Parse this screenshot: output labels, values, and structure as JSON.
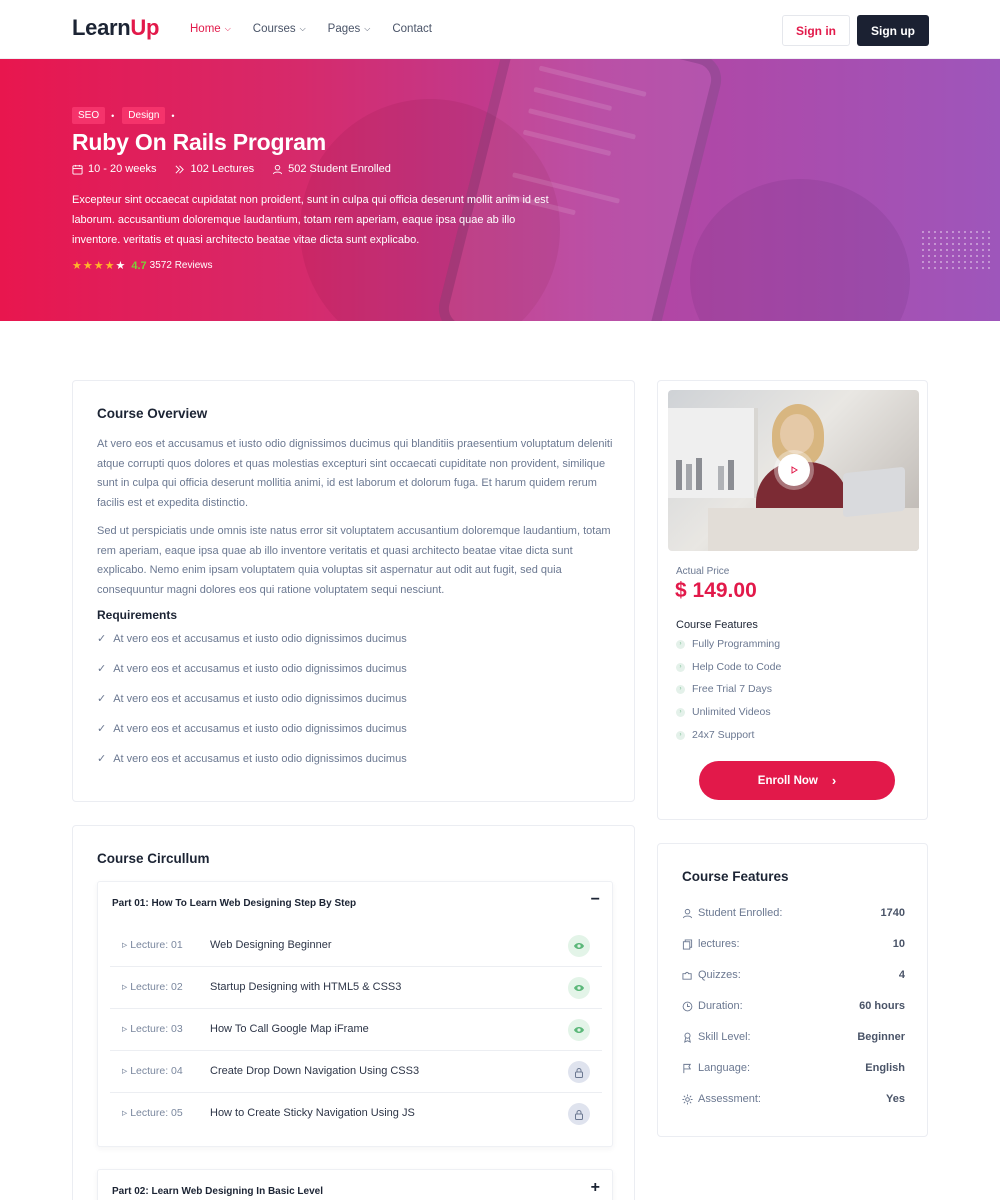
{
  "brand": {
    "logo_learn": "Learn",
    "logo_up": "Up"
  },
  "nav": {
    "items": [
      {
        "label": "Home",
        "has_dropdown": true,
        "active": true
      },
      {
        "label": "Courses",
        "has_dropdown": true,
        "active": false
      },
      {
        "label": "Pages",
        "has_dropdown": true,
        "active": false
      },
      {
        "label": "Contact",
        "has_dropdown": false,
        "active": false
      }
    ],
    "signin_label": "Sign in",
    "signup_label": "Sign up"
  },
  "hero": {
    "tags": [
      "SEO",
      "Design"
    ],
    "title": "Ruby On Rails Program",
    "meta": {
      "duration": "10 - 20 weeks",
      "lectures": "102 Lectures",
      "enrolled": "502 Student Enrolled"
    },
    "description": "Excepteur sint occaecat cupidatat non proident, sunt in culpa qui officia deserunt mollit anim id est laborum. accusantium doloremque laudantium, totam rem aperiam, eaque ipsa quae ab illo inventore. veritatis et quasi architecto beatae vitae dicta sunt explicabo.",
    "rating": {
      "stars": 4.5,
      "value": "4.7",
      "reviews": "3572 Reviews"
    }
  },
  "overview": {
    "title": "Course Overview",
    "paragraph1": "At vero eos et accusamus et iusto odio dignissimos ducimus qui blanditiis praesentium voluptatum deleniti atque corrupti quos dolores et quas molestias excepturi sint occaecati cupiditate non provident, similique sunt in culpa qui officia deserunt mollitia animi, id est laborum et dolorum fuga. Et harum quidem rerum facilis est et expedita distinctio.",
    "paragraph2": "Sed ut perspiciatis unde omnis iste natus error sit voluptatem accusantium doloremque laudantium, totam rem aperiam, eaque ipsa quae ab illo inventore veritatis et quasi architecto beatae vitae dicta sunt explicabo. Nemo enim ipsam voluptatem quia voluptas sit aspernatur aut odit aut fugit, sed quia consequuntur magni dolores eos qui ratione voluptatem sequi nesciunt.",
    "requirements_title": "Requirements",
    "requirements": [
      "At vero eos et accusamus et iusto odio dignissimos ducimus",
      "At vero eos et accusamus et iusto odio dignissimos ducimus",
      "At vero eos et accusamus et iusto odio dignissimos ducimus",
      "At vero eos et accusamus et iusto odio dignissimos ducimus",
      "At vero eos et accusamus et iusto odio dignissimos ducimus"
    ]
  },
  "curriculum": {
    "title": "Course Circullum",
    "parts": [
      {
        "title": "Part 01: How To Learn Web Designing Step By Step",
        "toggle": "−",
        "lectures": [
          {
            "num": "Lecture: 01",
            "name": "Web Designing Beginner",
            "icon": "eye-icon"
          },
          {
            "num": "Lecture: 02",
            "name": "Startup Designing with HTML5 & CSS3",
            "icon": "eye-icon"
          },
          {
            "num": "Lecture: 03",
            "name": "How To Call Google Map iFrame",
            "icon": "eye-icon"
          },
          {
            "num": "Lecture: 04",
            "name": "Create Drop Down Navigation Using CSS3",
            "icon": "lock-icon"
          },
          {
            "num": "Lecture: 05",
            "name": "How to Create Sticky Navigation Using JS",
            "icon": "lock-icon"
          }
        ]
      },
      {
        "title": "Part 02: Learn Web Designing In Basic Level",
        "toggle": "+"
      }
    ]
  },
  "pricing": {
    "price_label": "Actual Price",
    "price": "$ 149.00",
    "features_title": "Course Features",
    "features": [
      "Fully Programming",
      "Help Code to Code",
      "Free Trial 7 Days",
      "Unlimited Videos",
      "24x7 Support"
    ],
    "enroll_label": "Enroll Now"
  },
  "course_stats": {
    "title": "Course Features",
    "rows": [
      {
        "label": "Student Enrolled:",
        "value": "1740",
        "icon": "user-icon"
      },
      {
        "label": "lectures:",
        "value": "10",
        "icon": "copy-icon"
      },
      {
        "label": "Quizzes:",
        "value": "4",
        "icon": "puzzle-icon"
      },
      {
        "label": "Duration:",
        "value": "60 hours",
        "icon": "clock-icon"
      },
      {
        "label": "Skill Level:",
        "value": "Beginner",
        "icon": "award-icon"
      },
      {
        "label": "Language:",
        "value": "English",
        "icon": "flag-icon"
      },
      {
        "label": "Assessment:",
        "value": "Yes",
        "icon": "sun-icon"
      }
    ]
  },
  "colors": {
    "accent": "#e2194a",
    "dark": "#1b2132",
    "muted": "#6b7891"
  }
}
